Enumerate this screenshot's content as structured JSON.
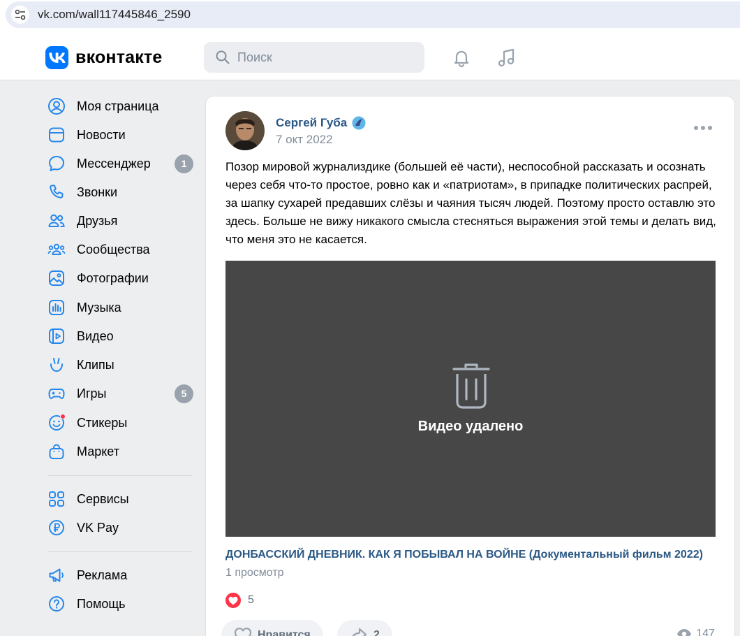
{
  "browser": {
    "url": "vk.com/wall117445846_2590"
  },
  "header": {
    "logo_text": "вконтакте",
    "search_placeholder": "Поиск"
  },
  "sidebar": {
    "items": [
      {
        "label": "Моя страница",
        "icon": "user-circle-icon"
      },
      {
        "label": "Новости",
        "icon": "news-icon"
      },
      {
        "label": "Мессенджер",
        "icon": "message-icon",
        "badge": "1"
      },
      {
        "label": "Звонки",
        "icon": "phone-icon"
      },
      {
        "label": "Друзья",
        "icon": "friends-icon"
      },
      {
        "label": "Сообщества",
        "icon": "communities-icon"
      },
      {
        "label": "Фотографии",
        "icon": "photo-icon"
      },
      {
        "label": "Музыка",
        "icon": "music-icon"
      },
      {
        "label": "Видео",
        "icon": "video-icon"
      },
      {
        "label": "Клипы",
        "icon": "clips-icon"
      },
      {
        "label": "Игры",
        "icon": "games-icon",
        "badge": "5"
      },
      {
        "label": "Стикеры",
        "icon": "stickers-icon"
      },
      {
        "label": "Маркет",
        "icon": "market-icon"
      },
      {
        "label": "Сервисы",
        "icon": "services-icon"
      },
      {
        "label": "VK Pay",
        "icon": "vkpay-icon"
      },
      {
        "label": "Реклама",
        "icon": "ads-icon"
      },
      {
        "label": "Помощь",
        "icon": "help-icon"
      }
    ]
  },
  "post": {
    "author": "Сергей Губа",
    "date": "7 окт 2022",
    "text": "Позор мировой журнализдике (большей её части), неспособной рассказать и осознать через себя что-то простое, ровно как и «патриотам», в припадке политических распрей, за шапку сухарей предавших слёзы и чаяния тысяч людей. Поэтому просто оставлю это здесь. Больше не вижу никакого смысла стесняться выражения этой темы и делать вид, что меня это не касается.",
    "video_message": "Видео удалено",
    "video_title": "ДОНБАССКИЙ ДНЕВНИК. КАК Я ПОБЫВАЛ НА ВОЙНЕ (Документальный фильм 2022)",
    "video_views": "1 просмотр",
    "reactions_count": "5",
    "like_label": "Нравится",
    "share_count": "2",
    "views_count": "147"
  },
  "colors": {
    "accent": "#0077ff",
    "link": "#2a5885",
    "like": "#ff3347"
  }
}
